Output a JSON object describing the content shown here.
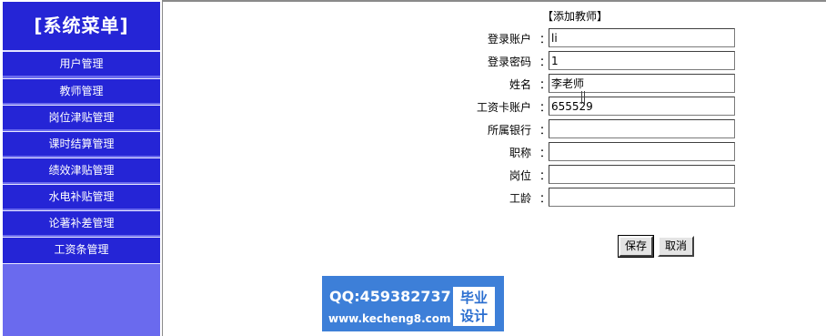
{
  "sidebar": {
    "title": "[系统菜单]",
    "items": [
      {
        "label": "用户管理"
      },
      {
        "label": "教师管理"
      },
      {
        "label": "岗位津贴管理"
      },
      {
        "label": "课时结算管理"
      },
      {
        "label": "绩效津贴管理"
      },
      {
        "label": "水电补贴管理"
      },
      {
        "label": "论著补差管理"
      },
      {
        "label": "工资条管理"
      }
    ]
  },
  "form": {
    "title": "【添加教师】",
    "fields": [
      {
        "label": "登录账户",
        "value": "li"
      },
      {
        "label": "登录密码",
        "value": "1"
      },
      {
        "label": "姓名",
        "value": "李老师"
      },
      {
        "label": "工资卡账户",
        "value": "655529"
      },
      {
        "label": "所属银行",
        "value": ""
      },
      {
        "label": "职称",
        "value": ""
      },
      {
        "label": "岗位",
        "value": ""
      },
      {
        "label": "工龄",
        "value": ""
      }
    ],
    "colon": "：",
    "save_label": "保存",
    "cancel_label": "取消"
  },
  "watermark": {
    "qq": "QQ:459382737",
    "url": "www.kecheng8.com",
    "badge_line1": "毕业",
    "badge_line2": "设计"
  },
  "colors": {
    "sidebar_bg": "#2525d6",
    "sidebar_fill": "#6a6aee",
    "watermark_bg": "#3d7fd8"
  }
}
